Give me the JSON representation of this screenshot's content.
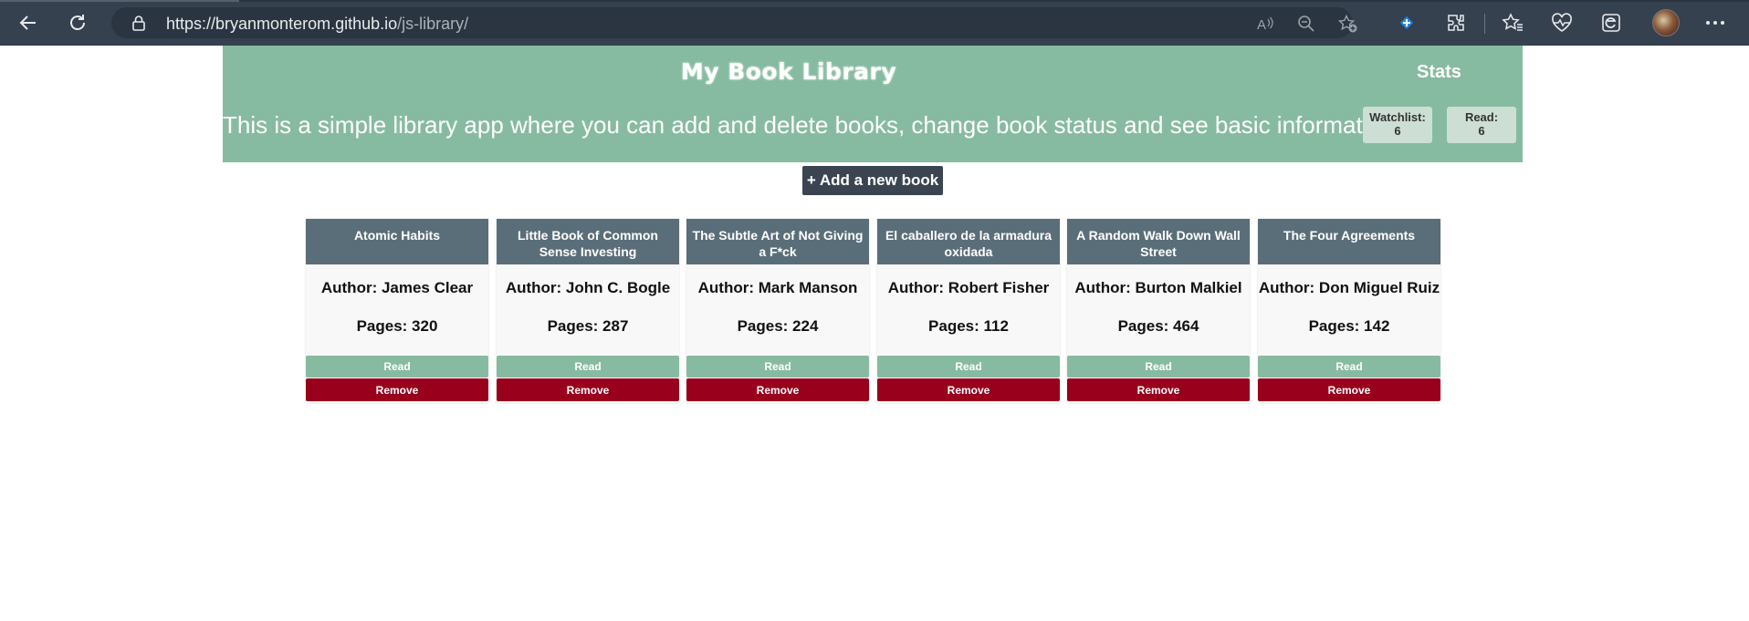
{
  "browser": {
    "url_host": "https://bryanmonterom.github.io",
    "url_path": "/js-library/"
  },
  "header": {
    "title": "My Book Library",
    "description": "This is a simple library app where you can add and delete books, change book status and see basic information.",
    "stats_title": "Stats",
    "watchlist_label": "Watchlist:",
    "watchlist_count": "6",
    "read_label": "Read:",
    "read_count": "6"
  },
  "add_button": "+ Add a new book",
  "books": [
    {
      "title": "Atomic Habits",
      "author": "Author: James Clear",
      "pages": "Pages: 320",
      "read_label": "Read",
      "remove_label": "Remove"
    },
    {
      "title": "Little Book of Common Sense Investing",
      "author": "Author: John C. Bogle",
      "pages": "Pages: 287",
      "read_label": "Read",
      "remove_label": "Remove"
    },
    {
      "title": "The Subtle Art of Not Giving a F*ck",
      "author": "Author: Mark Manson",
      "pages": "Pages: 224",
      "read_label": "Read",
      "remove_label": "Remove"
    },
    {
      "title": "El caballero de la armadura oxidada",
      "author": "Author: Robert Fisher",
      "pages": "Pages: 112",
      "read_label": "Read",
      "remove_label": "Remove"
    },
    {
      "title": "A Random Walk Down Wall Street",
      "author": "Author: Burton Malkiel",
      "pages": "Pages: 464",
      "read_label": "Read",
      "remove_label": "Remove"
    },
    {
      "title": "The Four Agreements",
      "author": "Author: Don Miguel Ruiz",
      "pages": "Pages: 142",
      "read_label": "Read",
      "remove_label": "Remove"
    }
  ],
  "colors": {
    "header_bg": "#87bba1",
    "card_title_bg": "#5a6e79",
    "remove_bg": "#98001c",
    "add_btn_bg": "#3a4551"
  }
}
